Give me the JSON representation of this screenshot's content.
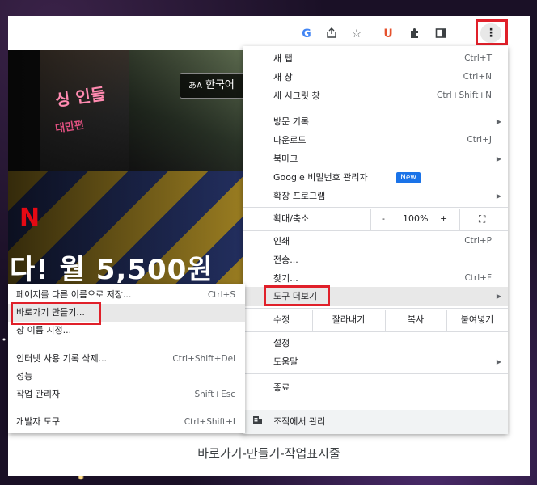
{
  "toolbar": {
    "icons": [
      "google-icon",
      "share-icon",
      "star-icon",
      "ublock-icon",
      "puzzle-icon",
      "sidepanel-icon",
      "more-vert-icon"
    ],
    "google_glyph": "G",
    "ublock_glyph": "U",
    "more_glyph": "⋮"
  },
  "page": {
    "poster_title": "싱 인들",
    "poster_sub": "대만편",
    "netflix_logo": "N",
    "language_button": "한국어",
    "language_glyph": "あA",
    "headline": "다! 월 5,500원"
  },
  "menu": {
    "new_tab": {
      "label": "새 탭",
      "shortcut": "Ctrl+T"
    },
    "new_window": {
      "label": "새 창",
      "shortcut": "Ctrl+N"
    },
    "incognito": {
      "label": "새 시크릿 창",
      "shortcut": "Ctrl+Shift+N"
    },
    "history": {
      "label": "방문 기록"
    },
    "downloads": {
      "label": "다운로드",
      "shortcut": "Ctrl+J"
    },
    "bookmarks": {
      "label": "북마크"
    },
    "passwords": {
      "label": "Google 비밀번호 관리자",
      "badge": "New"
    },
    "extensions": {
      "label": "확장 프로그램"
    },
    "zoom": {
      "label": "확대/축소",
      "minus": "-",
      "value": "100%",
      "plus": "+",
      "fullscreen": "⛶"
    },
    "print": {
      "label": "인쇄",
      "shortcut": "Ctrl+P"
    },
    "cast": {
      "label": "전송..."
    },
    "find": {
      "label": "찾기...",
      "shortcut": "Ctrl+F"
    },
    "more_tools": {
      "label": "도구 더보기"
    },
    "edit": {
      "label": "수정",
      "cut": "잘라내기",
      "copy": "복사",
      "paste": "붙여넣기"
    },
    "settings": {
      "label": "설정"
    },
    "help": {
      "label": "도움말"
    },
    "exit": {
      "label": "종료"
    },
    "managed": {
      "label": "조직에서 관리"
    }
  },
  "submenu": {
    "save_as": {
      "label": "페이지를 다른 이름으로 저장...",
      "shortcut": "Ctrl+S"
    },
    "create_shortcut": {
      "label": "바로가기 만들기..."
    },
    "name_window": {
      "label": "창 이름 지정..."
    },
    "clear_data": {
      "label": "인터넷 사용 기록 삭제...",
      "shortcut": "Ctrl+Shift+Del"
    },
    "performance": {
      "label": "성능"
    },
    "task_manager": {
      "label": "작업 관리자",
      "shortcut": "Shift+Esc"
    },
    "dev_tools": {
      "label": "개발자 도구",
      "shortcut": "Ctrl+Shift+I"
    }
  },
  "caption": "바로가기-만들기-작업표시줄",
  "colors": {
    "highlight_box": "#e0202a",
    "new_badge": "#1a73e8",
    "netflix_red": "#e50914"
  }
}
